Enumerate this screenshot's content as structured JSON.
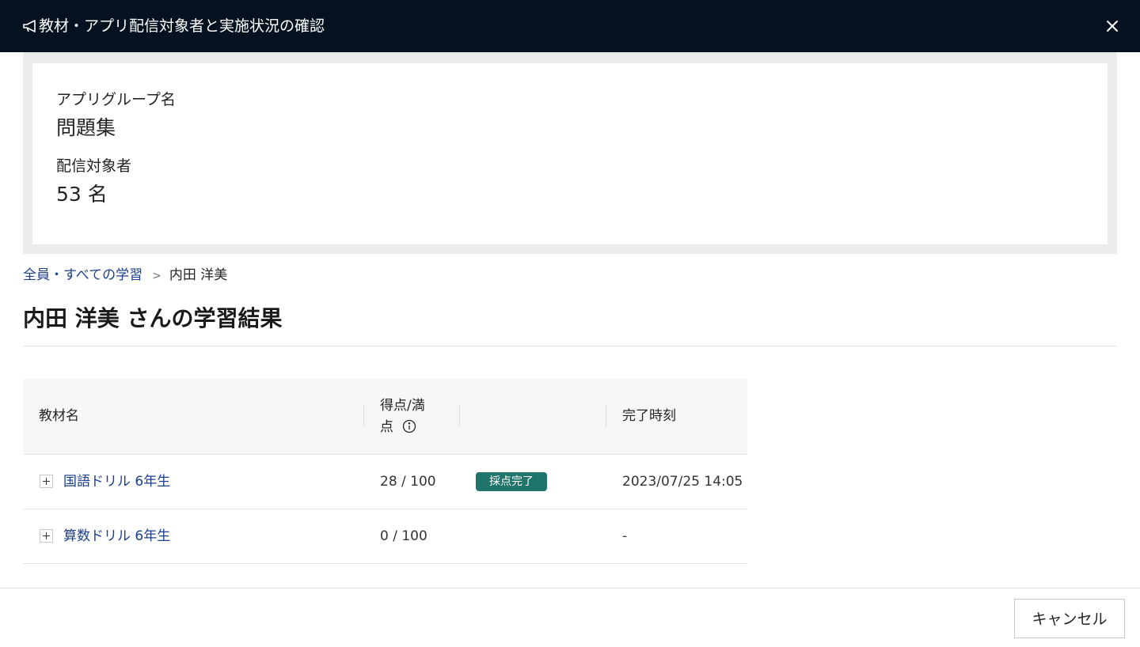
{
  "dialog": {
    "title": "教材・アプリ配信対象者と実施状況の確認",
    "icon": "megaphone-icon",
    "close_icon": "close-icon"
  },
  "summary": {
    "group_label": "アプリグループ名",
    "group_value": "問題集",
    "target_label": "配信対象者",
    "target_value": "53 名"
  },
  "breadcrumb": {
    "parent": "全員・すべての学習",
    "separator": ">",
    "current": "内田 洋美"
  },
  "page_title": "内田 洋美 さんの学習結果",
  "table": {
    "columns": {
      "name": "教材名",
      "score_line1": "得点/満",
      "score_line2": "点",
      "status": "",
      "completed": "完了時刻"
    },
    "info_icon": "info-icon",
    "rows": [
      {
        "name": "国語ドリル 6年生",
        "score": "28 / 100",
        "status": "採点完了",
        "completed": "2023/07/25 14:05"
      },
      {
        "name": "算数ドリル 6年生",
        "score": "0 / 100",
        "status": "",
        "completed": "-"
      }
    ]
  },
  "footer": {
    "cancel_label": "キャンセル"
  },
  "colors": {
    "titlebar_bg": "#04111f",
    "link": "#1c3f8c",
    "badge_bg": "#1f746b",
    "summary_bg": "#ececec"
  }
}
